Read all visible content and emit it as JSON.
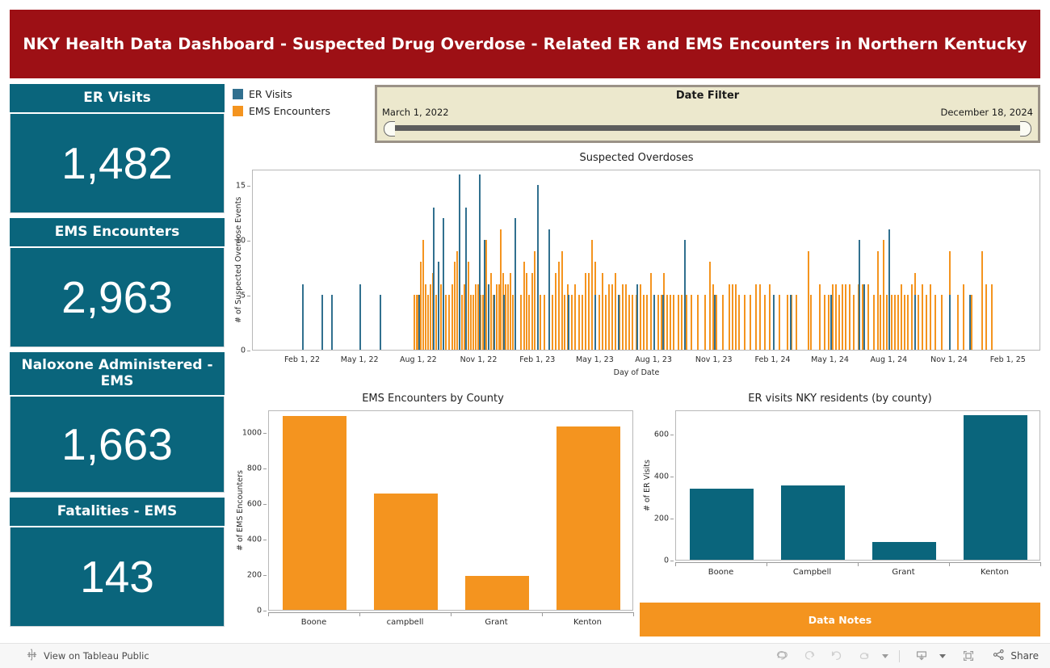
{
  "header": {
    "title": "NKY Health Data Dashboard - Suspected Drug Overdose - Related ER and EMS Encounters in Northern Kentucky",
    "band_color": "#9d1015"
  },
  "colors": {
    "teal": "#0a657c",
    "orange": "#f4941f",
    "banner_red": "#9d1015",
    "filter_bg": "#ece8cd"
  },
  "kpis": [
    {
      "label": "ER Visits",
      "value": "1,482"
    },
    {
      "label": "EMS Encounters",
      "value": "2,963"
    },
    {
      "label": "Naloxone Administered - EMS",
      "value": "1,663"
    },
    {
      "label": "Fatalities - EMS",
      "value": "143"
    }
  ],
  "legend": {
    "items": [
      {
        "label": "ER Visits",
        "color": "#31708f"
      },
      {
        "label": "EMS Encounters",
        "color": "#f4941f"
      }
    ]
  },
  "date_filter": {
    "title": "Date Filter",
    "start": "March 1, 2022",
    "end": "December 18, 2024"
  },
  "data_notes": {
    "label": "Data Notes"
  },
  "toolbar": {
    "view_public": "View on Tableau Public",
    "share": "Share",
    "icons": [
      "undo-icon",
      "redo-icon",
      "revert-icon",
      "refresh-icon",
      "download-icon",
      "fullscreen-icon",
      "share-icon"
    ]
  },
  "chart_data": [
    {
      "id": "timeseries",
      "type": "bar",
      "title": "Suspected Overdoses",
      "xlabel": "Day of Date",
      "ylabel": "# of Suspected Overdose Events",
      "ylim": [
        0,
        16.5
      ],
      "yticks": [
        0,
        5,
        10,
        15
      ],
      "grid": false,
      "legend_position": "top-left-external",
      "xticks": [
        "Feb 1, 22",
        "May 1, 22",
        "Aug 1, 22",
        "Nov 1, 22",
        "Feb 1, 23",
        "May 1, 23",
        "Aug 1, 23",
        "Nov 1, 23",
        "Feb 1, 24",
        "May 1, 24",
        "Aug 1, 24",
        "Nov 1, 24",
        "Feb 1, 25"
      ],
      "xtick_positions": [
        0.0636,
        0.1364,
        0.2109,
        0.2874,
        0.362,
        0.4348,
        0.5093,
        0.5858,
        0.6604,
        0.7331,
        0.8077,
        0.8842,
        0.9588
      ],
      "series": [
        {
          "name": "ER Visits",
          "color": "#31708f",
          "points": [
            [
              0.0636,
              6
            ],
            [
              0.088,
              5
            ],
            [
              0.1008,
              5
            ],
            [
              0.1364,
              6
            ],
            [
              0.162,
              5
            ],
            [
              0.2109,
              5
            ],
            [
              0.23,
              13
            ],
            [
              0.2352,
              8
            ],
            [
              0.242,
              12
            ],
            [
              0.262,
              16
            ],
            [
              0.27,
              13
            ],
            [
              0.2874,
              16
            ],
            [
              0.2936,
              10
            ],
            [
              0.299,
              6
            ],
            [
              0.306,
              5
            ],
            [
              0.319,
              5
            ],
            [
              0.333,
              12
            ],
            [
              0.362,
              15
            ],
            [
              0.376,
              11
            ],
            [
              0.401,
              5
            ],
            [
              0.4348,
              5
            ],
            [
              0.464,
              5
            ],
            [
              0.488,
              6
            ],
            [
              0.5093,
              5
            ],
            [
              0.52,
              5
            ],
            [
              0.548,
              10
            ],
            [
              0.5858,
              5
            ],
            [
              0.6604,
              5
            ],
            [
              0.682,
              5
            ],
            [
              0.7331,
              5
            ],
            [
              0.769,
              10
            ],
            [
              0.776,
              6
            ],
            [
              0.8077,
              11
            ],
            [
              0.84,
              5
            ],
            [
              0.8842,
              5
            ],
            [
              0.91,
              5
            ]
          ]
        },
        {
          "name": "EMS Encounters",
          "color": "#f4941f",
          "points": [
            [
              0.205,
              5
            ],
            [
              0.208,
              5
            ],
            [
              0.21,
              5
            ],
            [
              0.213,
              8
            ],
            [
              0.216,
              10
            ],
            [
              0.219,
              6
            ],
            [
              0.222,
              5
            ],
            [
              0.225,
              6
            ],
            [
              0.228,
              7
            ],
            [
              0.23,
              7
            ],
            [
              0.233,
              5
            ],
            [
              0.236,
              6
            ],
            [
              0.239,
              6
            ],
            [
              0.242,
              7
            ],
            [
              0.245,
              5
            ],
            [
              0.249,
              5
            ],
            [
              0.253,
              6
            ],
            [
              0.256,
              8
            ],
            [
              0.259,
              9
            ],
            [
              0.262,
              5
            ],
            [
              0.265,
              5
            ],
            [
              0.268,
              6
            ],
            [
              0.27,
              6
            ],
            [
              0.274,
              8
            ],
            [
              0.277,
              5
            ],
            [
              0.28,
              5
            ],
            [
              0.283,
              6
            ],
            [
              0.286,
              6
            ],
            [
              0.289,
              5
            ],
            [
              0.292,
              5
            ],
            [
              0.296,
              10
            ],
            [
              0.299,
              6
            ],
            [
              0.302,
              7
            ],
            [
              0.305,
              5
            ],
            [
              0.309,
              6
            ],
            [
              0.312,
              6
            ],
            [
              0.315,
              11
            ],
            [
              0.318,
              7
            ],
            [
              0.321,
              6
            ],
            [
              0.324,
              6
            ],
            [
              0.327,
              7
            ],
            [
              0.33,
              5
            ],
            [
              0.333,
              5
            ],
            [
              0.34,
              5
            ],
            [
              0.344,
              8
            ],
            [
              0.347,
              7
            ],
            [
              0.35,
              5
            ],
            [
              0.355,
              7
            ],
            [
              0.358,
              9
            ],
            [
              0.362,
              5
            ],
            [
              0.365,
              5
            ],
            [
              0.37,
              5
            ],
            [
              0.376,
              6
            ],
            [
              0.38,
              5
            ],
            [
              0.384,
              7
            ],
            [
              0.388,
              8
            ],
            [
              0.392,
              9
            ],
            [
              0.396,
              5
            ],
            [
              0.4,
              6
            ],
            [
              0.405,
              5
            ],
            [
              0.409,
              6
            ],
            [
              0.414,
              5
            ],
            [
              0.418,
              5
            ],
            [
              0.422,
              7
            ],
            [
              0.426,
              7
            ],
            [
              0.43,
              10
            ],
            [
              0.4348,
              8
            ],
            [
              0.44,
              5
            ],
            [
              0.444,
              7
            ],
            [
              0.448,
              5
            ],
            [
              0.452,
              6
            ],
            [
              0.456,
              6
            ],
            [
              0.46,
              7
            ],
            [
              0.465,
              5
            ],
            [
              0.469,
              6
            ],
            [
              0.473,
              6
            ],
            [
              0.477,
              5
            ],
            [
              0.482,
              5
            ],
            [
              0.487,
              5
            ],
            [
              0.492,
              6
            ],
            [
              0.496,
              5
            ],
            [
              0.5,
              5
            ],
            [
              0.505,
              7
            ],
            [
              0.5093,
              5
            ],
            [
              0.514,
              5
            ],
            [
              0.518,
              5
            ],
            [
              0.522,
              7
            ],
            [
              0.526,
              5
            ],
            [
              0.53,
              5
            ],
            [
              0.534,
              5
            ],
            [
              0.54,
              5
            ],
            [
              0.544,
              5
            ],
            [
              0.55,
              5
            ],
            [
              0.556,
              5
            ],
            [
              0.565,
              5
            ],
            [
              0.574,
              5
            ],
            [
              0.58,
              8
            ],
            [
              0.584,
              6
            ],
            [
              0.588,
              5
            ],
            [
              0.596,
              5
            ],
            [
              0.605,
              6
            ],
            [
              0.609,
              6
            ],
            [
              0.613,
              6
            ],
            [
              0.617,
              5
            ],
            [
              0.624,
              5
            ],
            [
              0.631,
              5
            ],
            [
              0.638,
              6
            ],
            [
              0.643,
              6
            ],
            [
              0.65,
              5
            ],
            [
              0.656,
              6
            ],
            [
              0.6604,
              5
            ],
            [
              0.668,
              5
            ],
            [
              0.678,
              5
            ],
            [
              0.683,
              5
            ],
            [
              0.69,
              5
            ],
            [
              0.705,
              9
            ],
            [
              0.708,
              5
            ],
            [
              0.719,
              6
            ],
            [
              0.725,
              5
            ],
            [
              0.731,
              5
            ],
            [
              0.736,
              6
            ],
            [
              0.74,
              6
            ],
            [
              0.744,
              5
            ],
            [
              0.748,
              6
            ],
            [
              0.752,
              6
            ],
            [
              0.757,
              6
            ],
            [
              0.762,
              5
            ],
            [
              0.768,
              6
            ],
            [
              0.774,
              6
            ],
            [
              0.781,
              6
            ],
            [
              0.788,
              5
            ],
            [
              0.793,
              9
            ],
            [
              0.796,
              5
            ],
            [
              0.8,
              10
            ],
            [
              0.804,
              5
            ],
            [
              0.81,
              5
            ],
            [
              0.815,
              5
            ],
            [
              0.819,
              5
            ],
            [
              0.823,
              6
            ],
            [
              0.827,
              5
            ],
            [
              0.831,
              5
            ],
            [
              0.836,
              6
            ],
            [
              0.84,
              7
            ],
            [
              0.844,
              5
            ],
            [
              0.849,
              6
            ],
            [
              0.854,
              5
            ],
            [
              0.86,
              6
            ],
            [
              0.866,
              5
            ],
            [
              0.874,
              5
            ],
            [
              0.8842,
              9
            ],
            [
              0.894,
              5
            ],
            [
              0.902,
              6
            ],
            [
              0.912,
              5
            ],
            [
              0.925,
              9
            ],
            [
              0.93,
              6
            ],
            [
              0.938,
              6
            ]
          ]
        }
      ]
    },
    {
      "id": "ems_by_county",
      "type": "bar",
      "title": "EMS Encounters by County",
      "xlabel": "",
      "ylabel": "# of EMS Encounters",
      "ylim": [
        0,
        1125
      ],
      "yticks": [
        0,
        200,
        400,
        600,
        800,
        1000
      ],
      "grid": false,
      "color": "#f4941f",
      "categories": [
        "Boone",
        "campbell",
        "Grant",
        "Kenton"
      ],
      "values": [
        1088,
        653,
        190,
        1030
      ]
    },
    {
      "id": "er_by_county",
      "type": "bar",
      "title": "ER visits NKY residents (by county)",
      "xlabel": "",
      "ylabel": "# of ER Visits",
      "ylim": [
        0,
        715
      ],
      "yticks": [
        0,
        200,
        400,
        600
      ],
      "grid": false,
      "color": "#0a657c",
      "categories": [
        "Boone",
        "Campbell",
        "Grant",
        "Kenton"
      ],
      "values": [
        340,
        353,
        84,
        690
      ]
    }
  ]
}
